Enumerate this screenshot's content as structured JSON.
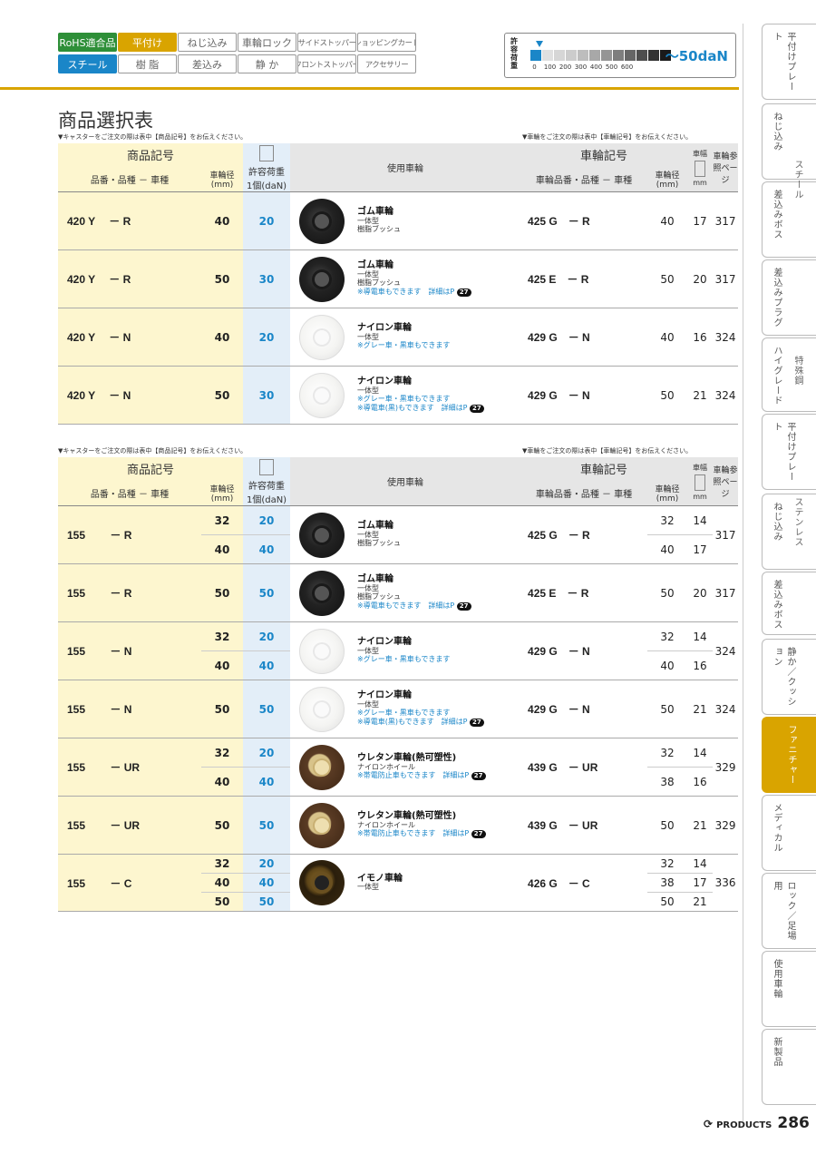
{
  "tags": {
    "row1": [
      "RoHS適合品",
      "平付け",
      "ねじ込み",
      "車輪ロック",
      "サイドストッパー",
      "ショッピングカート"
    ],
    "row2": [
      "スチール",
      "樹 脂",
      "差込み",
      "静 か",
      "フロントストッパー",
      "アクセサリー"
    ]
  },
  "load_scale": {
    "label": "許容荷重",
    "ticks": [
      "0",
      "100",
      "200",
      "300",
      "400",
      "500",
      "600"
    ],
    "range": "〜50daN",
    "level_daN": 50,
    "colors": [
      "#1a86c8",
      "#e0e0e0",
      "#d6d6d6",
      "#cccccc",
      "#bdbdbd",
      "#a8a8a8",
      "#959595",
      "#7e7e7e",
      "#666666",
      "#4e4e4e",
      "#333333",
      "#1a1a1a"
    ]
  },
  "title": "商品選択表",
  "notes": {
    "left": "▼キャスターをご注文の際は表中【商品記号】をお伝えください。",
    "right": "▼車輪をご注文の際は表中【車輪記号】をお伝えください。"
  },
  "headers": {
    "product_code": "商品記号",
    "product_sub": "品番・品種 － 車種",
    "wheel_dia": "車輪径",
    "mm": "(mm)",
    "load": "許容荷重",
    "load_unit": "1個(daN)",
    "wheel_used": "使用車輪",
    "wheel_code": "車輪記号",
    "wheel_sub": "車輪品番・品種 － 車種",
    "width": "車幅",
    "width_unit": "mm",
    "ref": "車輪参照ページ"
  },
  "table1": [
    {
      "code": "420 Y　 － R",
      "dia": "40",
      "load": "20",
      "wheel": "black",
      "name": "ゴム車輪",
      "d1": "一体型",
      "d2": "樹脂ブッシュ",
      "d3": "",
      "d4": "",
      "wcode": "425 G　－ R",
      "wdia": "40",
      "width": "17",
      "page": "317"
    },
    {
      "code": "420 Y　 － R",
      "dia": "50",
      "load": "30",
      "wheel": "black",
      "name": "ゴム車輪",
      "d1": "一体型",
      "d2": "樹脂ブッシュ",
      "d3": "※導電車もできます　詳細はP",
      "d3p": "27",
      "d4": "",
      "wcode": "425 E　－ R",
      "wdia": "50",
      "width": "20",
      "page": "317"
    },
    {
      "code": "420 Y　 － N",
      "dia": "40",
      "load": "20",
      "wheel": "white",
      "name": "ナイロン車輪",
      "d1": "一体型",
      "d2": "",
      "d3": "※グレー車・黒車もできます",
      "d4": "",
      "wcode": "429 G　－ N",
      "wdia": "40",
      "width": "16",
      "page": "324"
    },
    {
      "code": "420 Y　 － N",
      "dia": "50",
      "load": "30",
      "wheel": "white",
      "name": "ナイロン車輪",
      "d1": "一体型",
      "d2": "",
      "d3": "※グレー車・黒車もできます",
      "d4": "※導電車(黒)もできます　詳細はP",
      "d4p": "27",
      "wcode": "429 G　－ N",
      "wdia": "50",
      "width": "21",
      "page": "324"
    }
  ],
  "table2": [
    {
      "code": "155　　 － R",
      "rows": [
        [
          "32",
          "20"
        ],
        [
          "40",
          "40"
        ]
      ],
      "wheel": "black",
      "name": "ゴム車輪",
      "d1": "一体型",
      "d2": "樹脂ブッシュ",
      "d3": "",
      "d4": "",
      "wcode": "425 G　－ R",
      "wrows": [
        [
          "32",
          "14"
        ],
        [
          "40",
          "17"
        ]
      ],
      "page": "317"
    },
    {
      "code": "155　　 － R",
      "rows": [
        [
          "50",
          "50"
        ]
      ],
      "wheel": "black",
      "name": "ゴム車輪",
      "d1": "一体型",
      "d2": "樹脂ブッシュ",
      "d3": "※導電車もできます　詳細はP",
      "d3p": "27",
      "d4": "",
      "wcode": "425 E　－ R",
      "wrows": [
        [
          "50",
          "20"
        ]
      ],
      "page": "317"
    },
    {
      "code": "155　　 － N",
      "rows": [
        [
          "32",
          "20"
        ],
        [
          "40",
          "40"
        ]
      ],
      "wheel": "white",
      "name": "ナイロン車輪",
      "d1": "一体型",
      "d2": "",
      "d3": "※グレー車・黒車もできます",
      "d4": "",
      "wcode": "429 G　－ N",
      "wrows": [
        [
          "32",
          "14"
        ],
        [
          "40",
          "16"
        ]
      ],
      "page": "324"
    },
    {
      "code": "155　　 － N",
      "rows": [
        [
          "50",
          "50"
        ]
      ],
      "wheel": "white",
      "name": "ナイロン車輪",
      "d1": "一体型",
      "d2": "",
      "d3": "※グレー車・黒車もできます",
      "d4": "※導電車(黒)もできます　詳細はP",
      "d4p": "27",
      "wcode": "429 G　－ N",
      "wrows": [
        [
          "50",
          "21"
        ]
      ],
      "page": "324"
    },
    {
      "code": "155　　 － UR",
      "rows": [
        [
          "32",
          "20"
        ],
        [
          "40",
          "40"
        ]
      ],
      "wheel": "brown",
      "name": "ウレタン車輪(熱可塑性)",
      "d1": "ナイロンホイール",
      "d2": "",
      "d3": "※帯電防止車もできます　詳細はP",
      "d3p": "27",
      "d4": "",
      "wcode": "439 G　－ UR",
      "wrows": [
        [
          "32",
          "14"
        ],
        [
          "38",
          "16"
        ]
      ],
      "page": "329"
    },
    {
      "code": "155　　 － UR",
      "rows": [
        [
          "50",
          "50"
        ]
      ],
      "wheel": "brown",
      "name": "ウレタン車輪(熱可塑性)",
      "d1": "ナイロンホイール",
      "d2": "",
      "d3": "※帯電防止車もできます　詳細はP",
      "d3p": "27",
      "d4": "",
      "wcode": "439 G　－ UR",
      "wrows": [
        [
          "50",
          "21"
        ]
      ],
      "page": "329"
    },
    {
      "code": "155　　 － C",
      "rows": [
        [
          "32",
          "20"
        ],
        [
          "40",
          "40"
        ],
        [
          "50",
          "50"
        ]
      ],
      "wheel": "cast",
      "name": "イモノ車輪",
      "d1": "一体型",
      "d2": "",
      "d3": "",
      "d4": "",
      "wcode": "426 G　－ C",
      "wrows": [
        [
          "32",
          "14"
        ],
        [
          "38",
          "17"
        ],
        [
          "50",
          "21"
        ]
      ],
      "page": "336"
    }
  ],
  "side_tabs": [
    {
      "label": "平付けプレート",
      "active": false
    },
    {
      "label": "ねじ込み",
      "active": false
    },
    {
      "label": "差込みボス",
      "active": false
    },
    {
      "label": "差込みプラグ",
      "active": false
    },
    {
      "label": "ハイグレード",
      "active": false
    },
    {
      "label": "平付けプレート",
      "active": false
    },
    {
      "label": "ねじ込み",
      "active": false
    },
    {
      "label": "差込みボス",
      "active": false
    },
    {
      "label": "静か／クッション",
      "active": false
    },
    {
      "label": "ファニチャー",
      "active": true
    },
    {
      "label": "メディカル",
      "active": false
    },
    {
      "label": "ロック／足場用",
      "active": false
    },
    {
      "label": "使用車輪",
      "active": false
    },
    {
      "label": "新製品",
      "active": false
    }
  ],
  "side_groups": [
    "スチール",
    "特殊鋼",
    "ステンレス"
  ],
  "footer": {
    "label": "PRODUCTS",
    "page": "286"
  }
}
